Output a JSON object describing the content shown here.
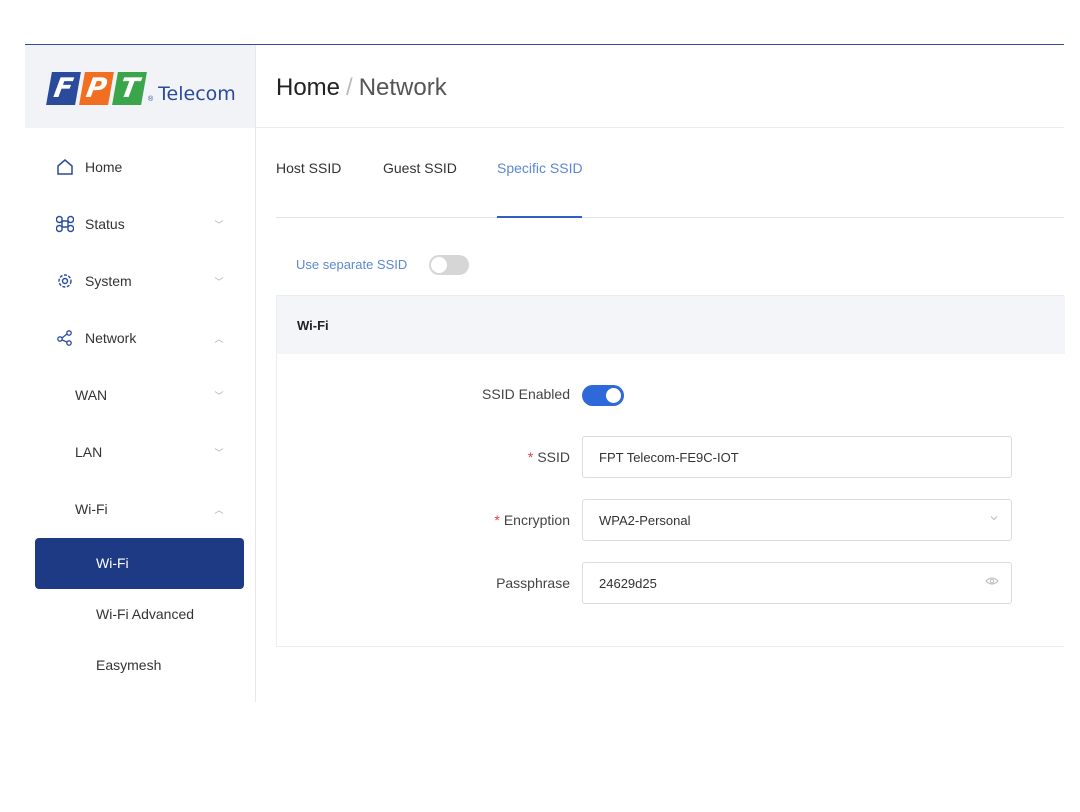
{
  "brand": {
    "letters": [
      "F",
      "P",
      "T"
    ],
    "letter_colors": [
      "#2a4a9c",
      "#f26f21",
      "#3aa54a"
    ],
    "text": "Telecom",
    "reg": "®"
  },
  "sidebar": {
    "items": [
      {
        "label": "Home",
        "icon": "home-icon"
      },
      {
        "label": "Status",
        "icon": "command-icon",
        "chevron": "﹀"
      },
      {
        "label": "System",
        "icon": "gear-icon",
        "chevron": "﹀"
      },
      {
        "label": "Network",
        "icon": "share-icon",
        "chevron": "︿"
      },
      {
        "label": "WAN",
        "chevron": "﹀"
      },
      {
        "label": "LAN",
        "chevron": "﹀"
      },
      {
        "label": "Wi-Fi",
        "chevron": "︿"
      }
    ],
    "active": "Wi-Fi",
    "subitems": [
      "Wi-Fi Advanced",
      "Easymesh"
    ]
  },
  "breadcrumb": {
    "home": "Home",
    "separator": "/",
    "current": "Network"
  },
  "tabs": [
    "Host SSID",
    "Guest SSID",
    "Specific SSID"
  ],
  "active_tab": "Specific SSID",
  "separate_ssid": {
    "label": "Use separate SSID",
    "enabled": false
  },
  "card": {
    "title": "Wi-Fi",
    "ssid_enabled_label": "SSID Enabled",
    "ssid_enabled": true,
    "required_mark": "*",
    "ssid_label": "SSID",
    "ssid_value": "FPT Telecom-FE9C-IOT",
    "encryption_label": "Encryption",
    "encryption_value": "WPA2-Personal",
    "passphrase_label": "Passphrase",
    "passphrase_value": "24629d25"
  },
  "colors": {
    "accent": "#2f68d8",
    "active_nav": "#1e3a85",
    "link": "#5b87d6"
  }
}
